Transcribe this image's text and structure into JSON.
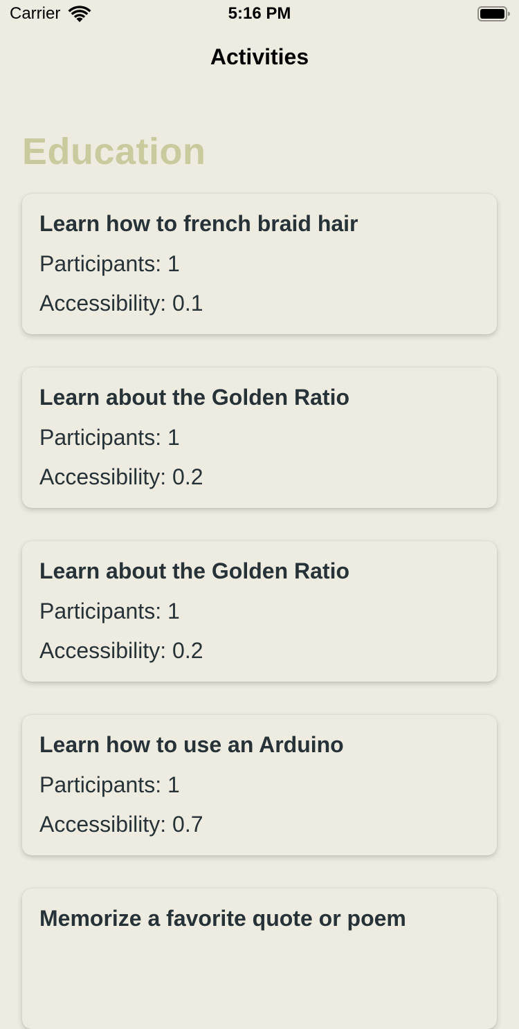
{
  "status_bar": {
    "carrier": "Carrier",
    "time": "5:16 PM",
    "wifi_icon": "wifi-icon",
    "battery_icon": "battery-icon"
  },
  "nav": {
    "title": "Activities"
  },
  "section": {
    "title": "Education",
    "title_color": "#C9CA9E"
  },
  "cards": [
    {
      "title": "Learn how to french braid hair",
      "participants": "Participants: 1",
      "accessibility": "Accessibility: 0.1"
    },
    {
      "title": "Learn about the Golden Ratio",
      "participants": "Participants: 1",
      "accessibility": "Accessibility: 0.2"
    },
    {
      "title": "Learn about the Golden Ratio",
      "participants": "Participants: 1",
      "accessibility": "Accessibility: 0.2"
    },
    {
      "title": "Learn how to use an Arduino",
      "participants": "Participants: 1",
      "accessibility": "Accessibility: 0.7"
    },
    {
      "title": "Memorize a favorite quote or poem",
      "participants": "",
      "accessibility": ""
    }
  ],
  "colors": {
    "background": "#EEECE0",
    "text": "#263238"
  }
}
